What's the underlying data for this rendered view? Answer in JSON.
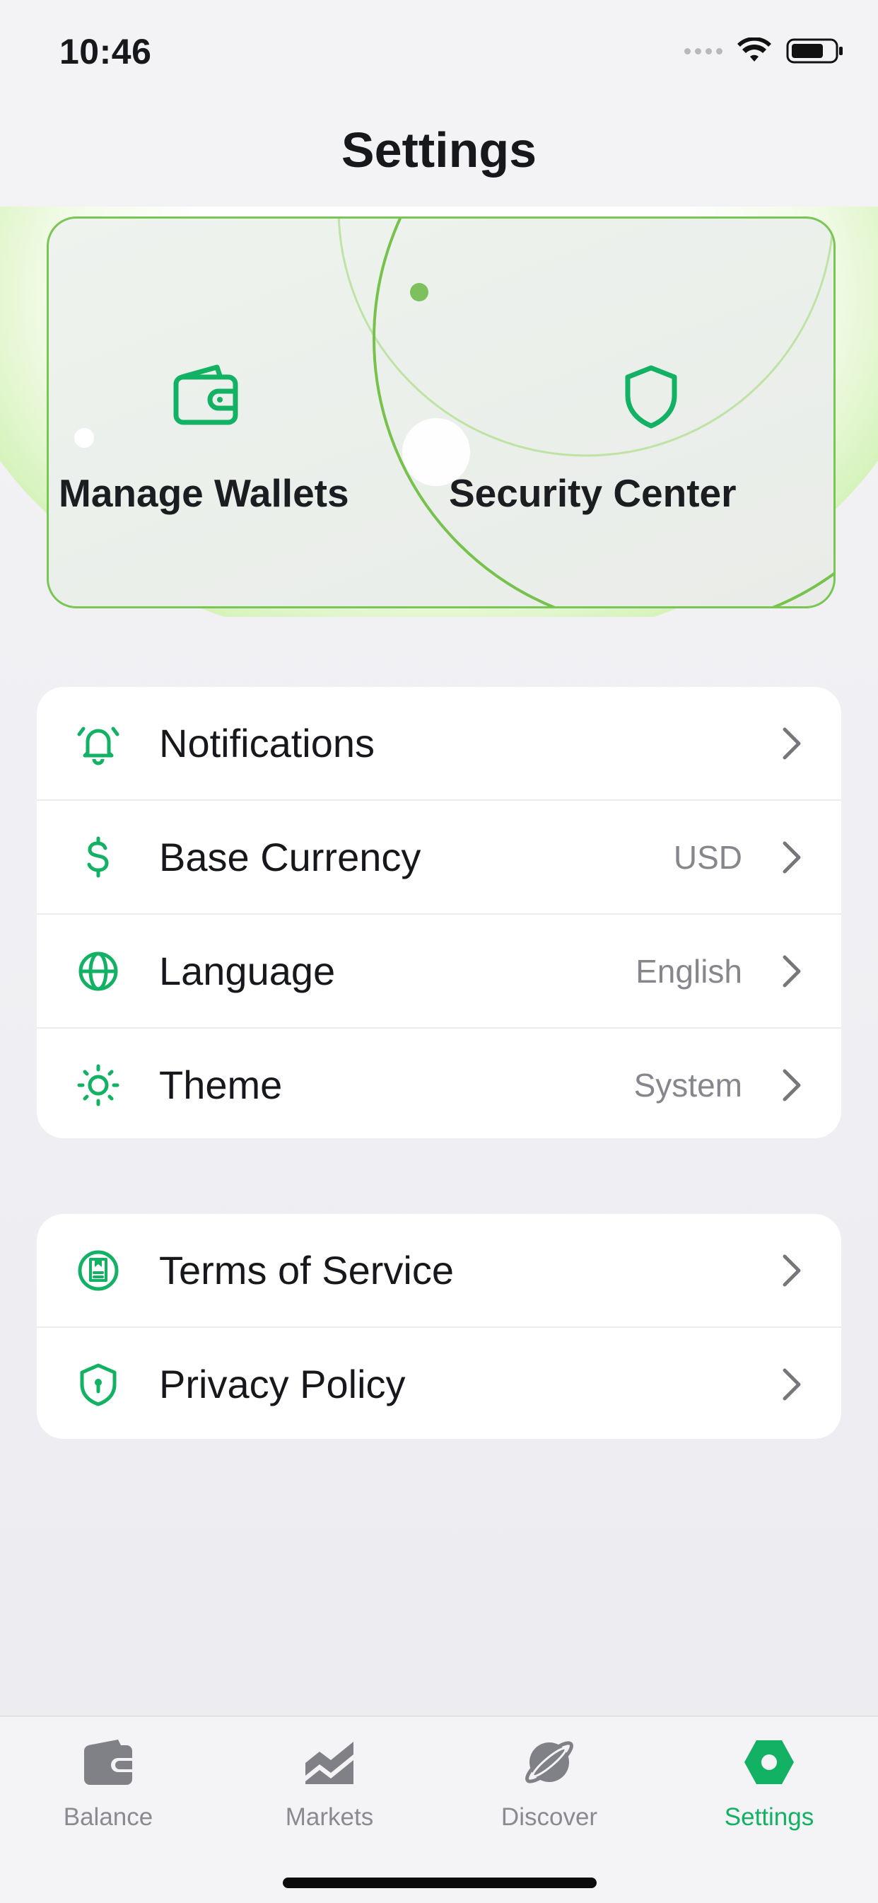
{
  "status_bar": {
    "time": "10:46"
  },
  "header": {
    "title": "Settings"
  },
  "hero": {
    "tiles": [
      {
        "label": "Manage Wallets",
        "icon": "wallet-icon"
      },
      {
        "label": "Security Center",
        "icon": "shield-icon"
      }
    ]
  },
  "groups": [
    {
      "rows": [
        {
          "label": "Notifications",
          "value": "",
          "icon": "bell-icon"
        },
        {
          "label": "Base Currency",
          "value": "USD",
          "icon": "dollar-icon"
        },
        {
          "label": "Language",
          "value": "English",
          "icon": "globe-icon"
        },
        {
          "label": "Theme",
          "value": "System",
          "icon": "sun-icon"
        }
      ]
    },
    {
      "rows": [
        {
          "label": "Terms of Service",
          "value": "",
          "icon": "document-icon"
        },
        {
          "label": "Privacy Policy",
          "value": "",
          "icon": "privacy-shield-icon"
        }
      ]
    }
  ],
  "tab_bar": {
    "tabs": [
      {
        "label": "Balance",
        "icon": "wallet-tab-icon",
        "active": false
      },
      {
        "label": "Markets",
        "icon": "chart-tab-icon",
        "active": false
      },
      {
        "label": "Discover",
        "icon": "planet-tab-icon",
        "active": false
      },
      {
        "label": "Settings",
        "icon": "hexagon-tab-icon",
        "active": true
      }
    ]
  },
  "colors": {
    "accent": "#12b163",
    "hero_border": "#79c655",
    "inactive": "#8a8b90"
  }
}
